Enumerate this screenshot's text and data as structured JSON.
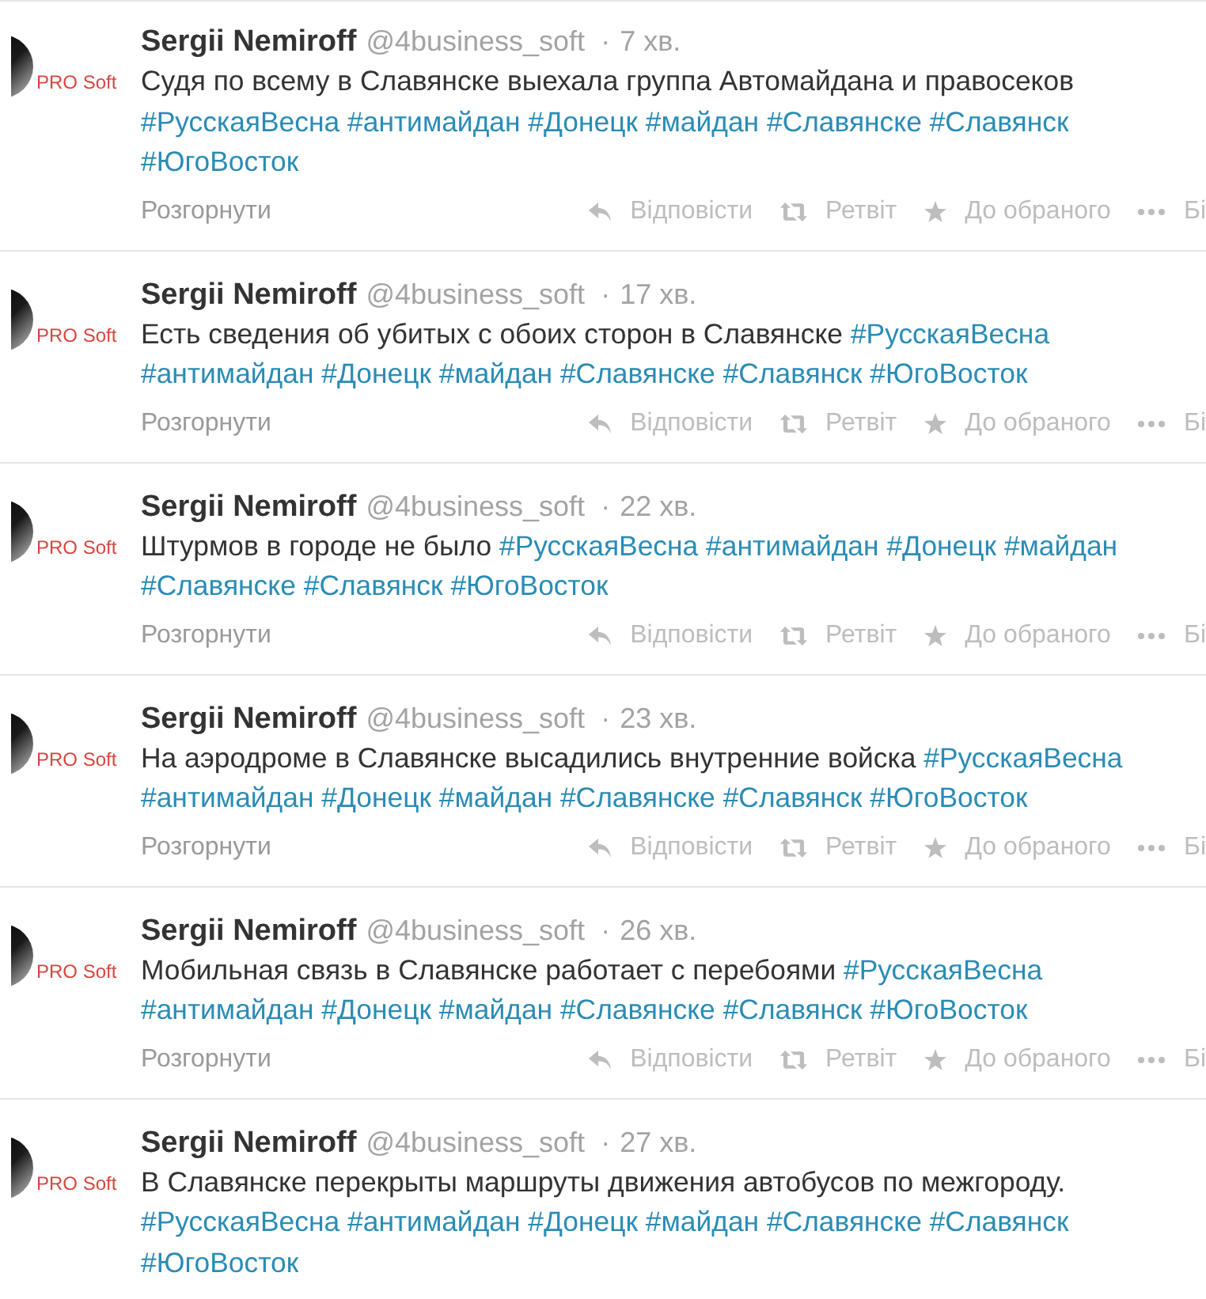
{
  "tweets": [
    {
      "avatar": {
        "logo_text": "PRO Soft"
      },
      "author": "Sergii Nemiroff",
      "handle": "@4business_soft",
      "separator": "·",
      "time": "7 хв.",
      "text": "Судя по всему в Славянске выехала группа Автомайдана и правосеков",
      "hashtags": [
        "#РусскаяВесна",
        "#антимайдан",
        "#Донецк",
        "#майдан",
        "#Славянске",
        "#Славянск",
        "#ЮгоВосток"
      ],
      "expand": "Розгорнути",
      "actions": [
        {
          "kind": "reply",
          "label": "Відповісти"
        },
        {
          "kind": "retweet",
          "label": "Ретвіт"
        },
        {
          "kind": "favorite",
          "label": "До обраного"
        },
        {
          "kind": "more",
          "label": "Бі"
        }
      ]
    },
    {
      "avatar": {
        "logo_text": "PRO Soft"
      },
      "author": "Sergii Nemiroff",
      "handle": "@4business_soft",
      "separator": "·",
      "time": "17 хв.",
      "text": "Есть сведения об убитых с обоих сторон в Славянске",
      "hashtags": [
        "#РусскаяВесна",
        "#антимайдан",
        "#Донецк",
        "#майдан",
        "#Славянске",
        "#Славянск",
        "#ЮгоВосток"
      ],
      "expand": "Розгорнути",
      "actions": [
        {
          "kind": "reply",
          "label": "Відповісти"
        },
        {
          "kind": "retweet",
          "label": "Ретвіт"
        },
        {
          "kind": "favorite",
          "label": "До обраного"
        },
        {
          "kind": "more",
          "label": "Бі"
        }
      ]
    },
    {
      "avatar": {
        "logo_text": "PRO Soft"
      },
      "author": "Sergii Nemiroff",
      "handle": "@4business_soft",
      "separator": "·",
      "time": "22 хв.",
      "text": "Штурмов в городе не было",
      "hashtags": [
        "#РусскаяВесна",
        "#антимайдан",
        "#Донецк",
        "#майдан",
        "#Славянске",
        "#Славянск",
        "#ЮгоВосток"
      ],
      "expand": "Розгорнути",
      "actions": [
        {
          "kind": "reply",
          "label": "Відповісти"
        },
        {
          "kind": "retweet",
          "label": "Ретвіт"
        },
        {
          "kind": "favorite",
          "label": "До обраного"
        },
        {
          "kind": "more",
          "label": "Бі"
        }
      ]
    },
    {
      "avatar": {
        "logo_text": "PRO Soft"
      },
      "author": "Sergii Nemiroff",
      "handle": "@4business_soft",
      "separator": "·",
      "time": "23 хв.",
      "text": "На аэродроме в Славянске высадились внутренние войска",
      "hashtags": [
        "#РусскаяВесна",
        "#антимайдан",
        "#Донецк",
        "#майдан",
        "#Славянске",
        "#Славянск",
        "#ЮгоВосток"
      ],
      "expand": "Розгорнути",
      "actions": [
        {
          "kind": "reply",
          "label": "Відповісти"
        },
        {
          "kind": "retweet",
          "label": "Ретвіт"
        },
        {
          "kind": "favorite",
          "label": "До обраного"
        },
        {
          "kind": "more",
          "label": "Бі"
        }
      ]
    },
    {
      "avatar": {
        "logo_text": "PRO Soft"
      },
      "author": "Sergii Nemiroff",
      "handle": "@4business_soft",
      "separator": "·",
      "time": "26 хв.",
      "text": "Мобильная связь в Славянске работает с перебоями",
      "hashtags": [
        "#РусскаяВесна",
        "#антимайдан",
        "#Донецк",
        "#майдан",
        "#Славянске",
        "#Славянск",
        "#ЮгоВосток"
      ],
      "expand": "Розгорнути",
      "actions": [
        {
          "kind": "reply",
          "label": "Відповісти"
        },
        {
          "kind": "retweet",
          "label": "Ретвіт"
        },
        {
          "kind": "favorite",
          "label": "До обраного"
        },
        {
          "kind": "more",
          "label": "Бі"
        }
      ]
    },
    {
      "avatar": {
        "logo_text": "PRO Soft"
      },
      "author": "Sergii Nemiroff",
      "handle": "@4business_soft",
      "separator": "·",
      "time": "27 хв.",
      "text": "В Славянске перекрыты маршруты движения автобусов по межгороду.",
      "hashtags": [
        "#РусскаяВесна",
        "#антимайдан",
        "#Донецк",
        "#майдан",
        "#Славянске",
        "#Славянск",
        "#ЮгоВосток"
      ]
    }
  ]
}
